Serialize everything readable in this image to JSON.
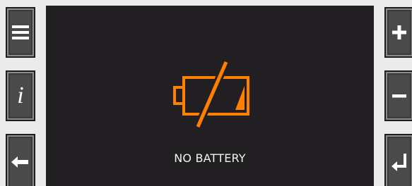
{
  "left_buttons": [
    {
      "icon": "menu-icon"
    },
    {
      "icon": "info-icon",
      "glyph": "i"
    },
    {
      "icon": "arrow-left-icon"
    }
  ],
  "right_buttons": [
    {
      "icon": "plus-icon"
    },
    {
      "icon": "minus-icon"
    },
    {
      "icon": "enter-icon"
    }
  ],
  "screen": {
    "status_text": "NO BATTERY",
    "icon": "no-battery-icon",
    "accent_color": "#ff7f00",
    "background_color": "#221f22"
  }
}
